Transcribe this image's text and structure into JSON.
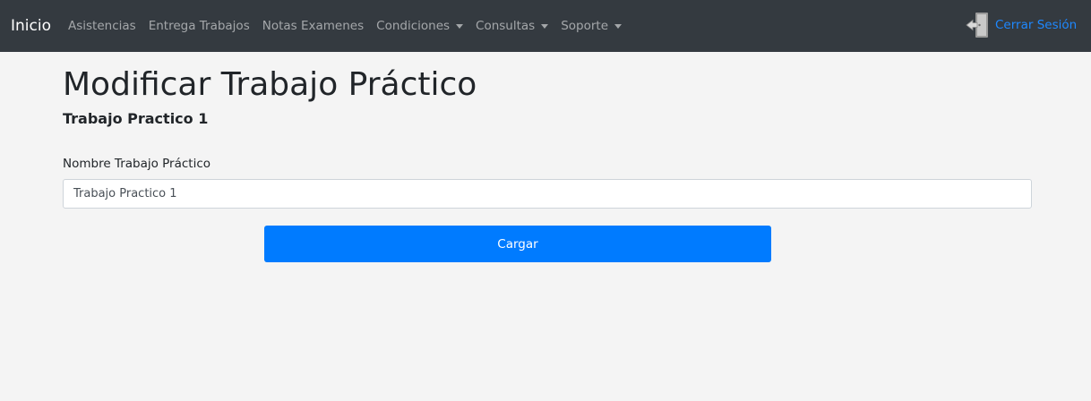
{
  "navbar": {
    "brand": "Inicio",
    "items": [
      {
        "label": "Asistencias",
        "dropdown": false
      },
      {
        "label": "Entrega Trabajos",
        "dropdown": false
      },
      {
        "label": "Notas Examenes",
        "dropdown": false
      },
      {
        "label": "Condiciones",
        "dropdown": true
      },
      {
        "label": "Consultas",
        "dropdown": true
      },
      {
        "label": "Soporte",
        "dropdown": true
      }
    ],
    "logout_label": "Cerrar Sesión",
    "logout_icon": "logout-door-icon"
  },
  "page": {
    "title": "Modificar Trabajo Práctico",
    "subtitle": "Trabajo Practico 1"
  },
  "form": {
    "name_label": "Nombre Trabajo Práctico",
    "name_value": "Trabajo Practico 1",
    "submit_label": "Cargar"
  },
  "colors": {
    "navbar_bg": "#343a40",
    "page_bg": "#f4f4f4",
    "primary": "#007bff",
    "logout_link": "#1e88ff"
  }
}
